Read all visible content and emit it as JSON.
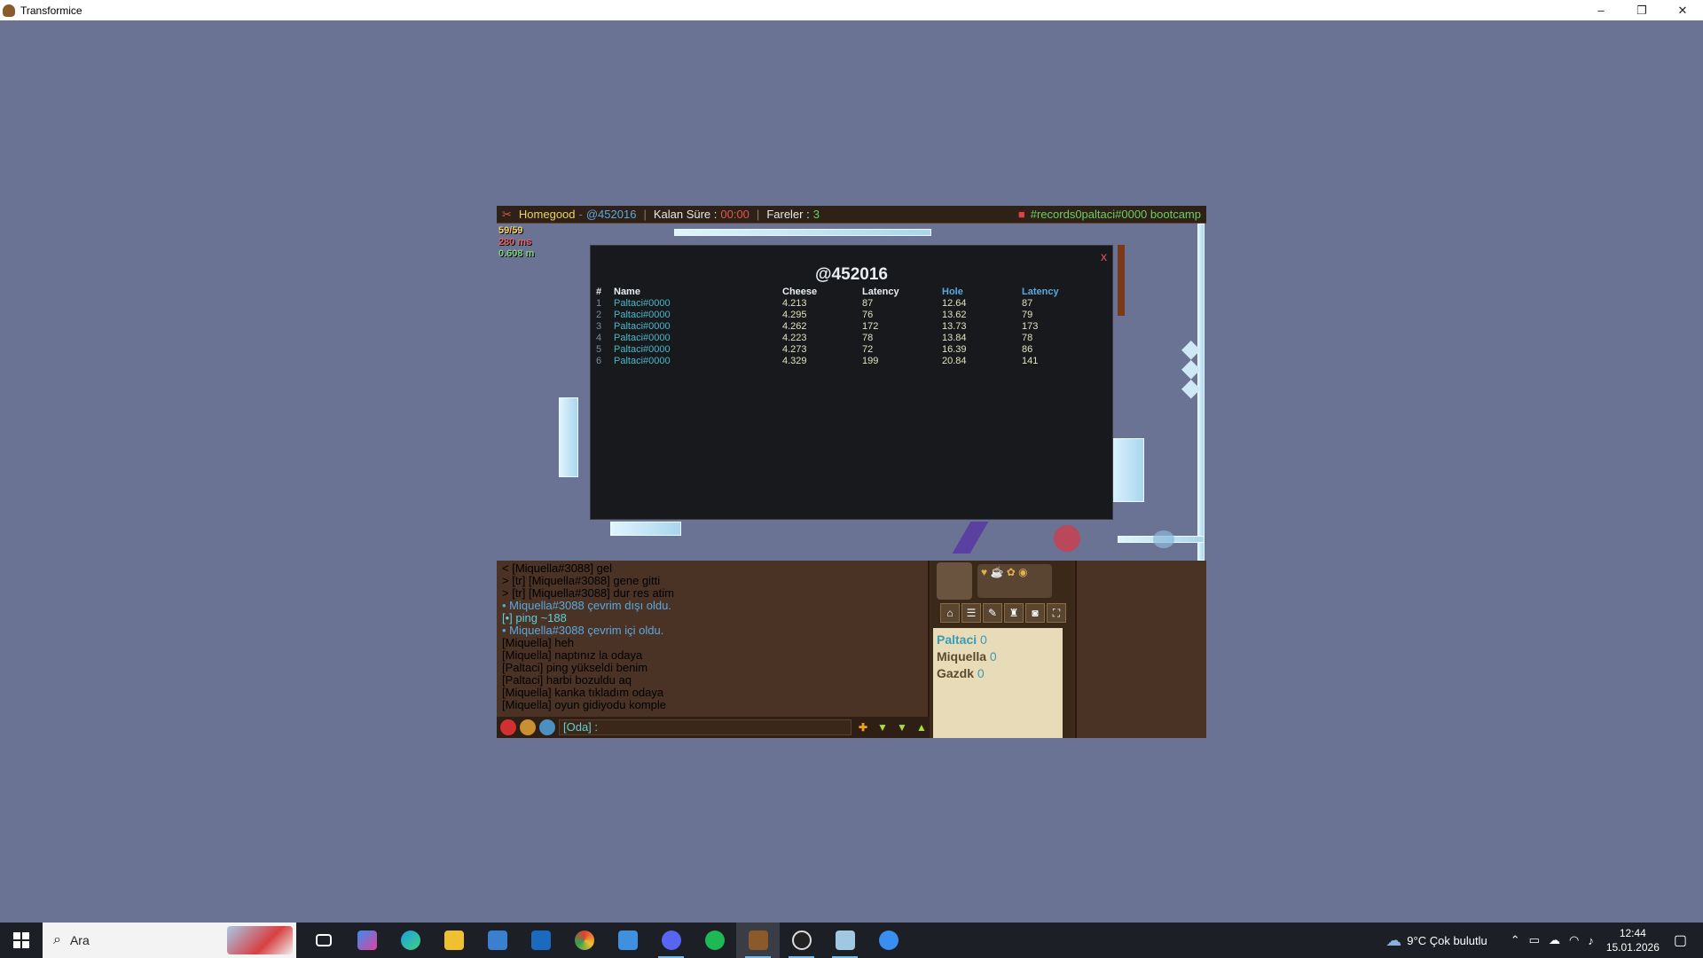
{
  "window": {
    "title": "Transformice",
    "minimize": "–",
    "restore": "❐",
    "close": "✕"
  },
  "hud": {
    "room_owner": "Homegood",
    "map_code": "@452016",
    "time_label": "Kalan Süre :",
    "time_value": "00:00",
    "mice_label": "Fareler :",
    "mice_value": "3",
    "room_name": "#records0paltaci#0000 bootcamp"
  },
  "stats": {
    "fps": "59/59",
    "ping": "280 ms",
    "mem": "0.608 m"
  },
  "dialog": {
    "title": "@452016",
    "close": "x",
    "headers": [
      "#",
      "Name",
      "Cheese",
      "Latency",
      "Hole",
      "Latency"
    ],
    "rows": [
      [
        "1",
        "Paltaci#0000",
        "4.213",
        "87",
        "12.64",
        "87"
      ],
      [
        "2",
        "Paltaci#0000",
        "4.295",
        "76",
        "13.62",
        "79"
      ],
      [
        "3",
        "Paltaci#0000",
        "4.262",
        "172",
        "13.73",
        "173"
      ],
      [
        "4",
        "Paltaci#0000",
        "4.223",
        "78",
        "13.84",
        "78"
      ],
      [
        "5",
        "Paltaci#0000",
        "4.273",
        "72",
        "16.39",
        "86"
      ],
      [
        "6",
        "Paltaci#0000",
        "4.329",
        "199",
        "20.84",
        "141"
      ]
    ]
  },
  "chat": {
    "lines": [
      {
        "text": "< [Miquella#3088] gel",
        "color": "#f0e0c0"
      },
      {
        "text": "> [tr] [Miquella#3088] gene gitti",
        "color": "#f0e0c0"
      },
      {
        "text": "> [tr] [Miquella#3088] dur res atim",
        "color": "#f0e0c0"
      },
      {
        "text": "• Miquella#3088 çevrim dışı oldu.",
        "color": "#5aa8e0"
      },
      {
        "text": "[•] ping ~188",
        "color": "#5ad0e0"
      },
      {
        "text": "• Miquella#3088 çevrim içi oldu.",
        "color": "#5aa8e0"
      },
      {
        "text": "[Miquella] heh",
        "color": "#f0e0c0"
      },
      {
        "text": "[Miquella] naptınız la odaya",
        "color": "#f0e0c0"
      },
      {
        "text": "[Paltaci] ping yükseldi benim",
        "color": "#f0e0c0"
      },
      {
        "text": "[Paltaci] harbi bozuldu aq",
        "color": "#f0e0c0"
      },
      {
        "text": "[Miquella] kanka tıkladım odaya",
        "color": "#f0e0c0"
      },
      {
        "text": "[Miquella] oyun gidiyodu komple",
        "color": "#f0e0c0"
      }
    ],
    "input_label": "[Oda] :"
  },
  "players": [
    {
      "name": "Paltaci",
      "score": "0"
    },
    {
      "name": "Miquella",
      "score": "0"
    },
    {
      "name": "Gazdk",
      "score": "0"
    }
  ],
  "tools": [
    "⌂",
    "☰",
    "✎",
    "♜",
    "◙",
    "⛶"
  ],
  "taskbar": {
    "search_placeholder": "Ara",
    "apps": [
      "task-view",
      "copilot",
      "edge",
      "file-explorer",
      "store",
      "outlook",
      "chrome",
      "mail-app",
      "discord",
      "spotify",
      "transformice",
      "obs",
      "notes",
      "settings"
    ],
    "weather": "9°C  Çok bulutlu",
    "time": "12:44",
    "date": "15.01.2026"
  },
  "colors": {
    "background": "#6b7394",
    "hud_gold": "#f0d060",
    "hud_blue": "#5aa8e0",
    "accent_green": "#a6e22e"
  }
}
